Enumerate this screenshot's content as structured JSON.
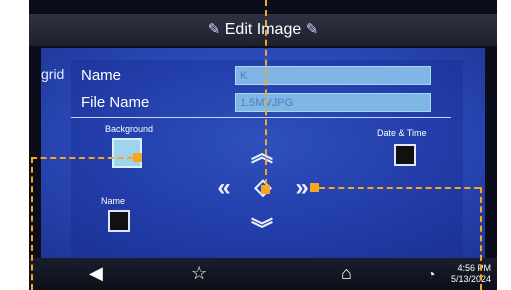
{
  "title": "Edit Image",
  "grid_label": "grid",
  "fields": [
    {
      "label": "Name",
      "value": "K"
    },
    {
      "label": "File Name",
      "value": "1.5MVJPG"
    }
  ],
  "options": {
    "background_label": "Background",
    "date_time_label": "Date & Time",
    "name_label": "Name"
  },
  "clock": {
    "time": "4:56 PM",
    "date": "5/13/2024"
  },
  "icons": {
    "pencil": "pencil-icon",
    "back": "back-icon",
    "favorite": "star-icon",
    "home": "home-icon",
    "wifi": "wifi-icon"
  },
  "colors": {
    "accent": "#f5a623",
    "panel": "#2a49b8"
  }
}
